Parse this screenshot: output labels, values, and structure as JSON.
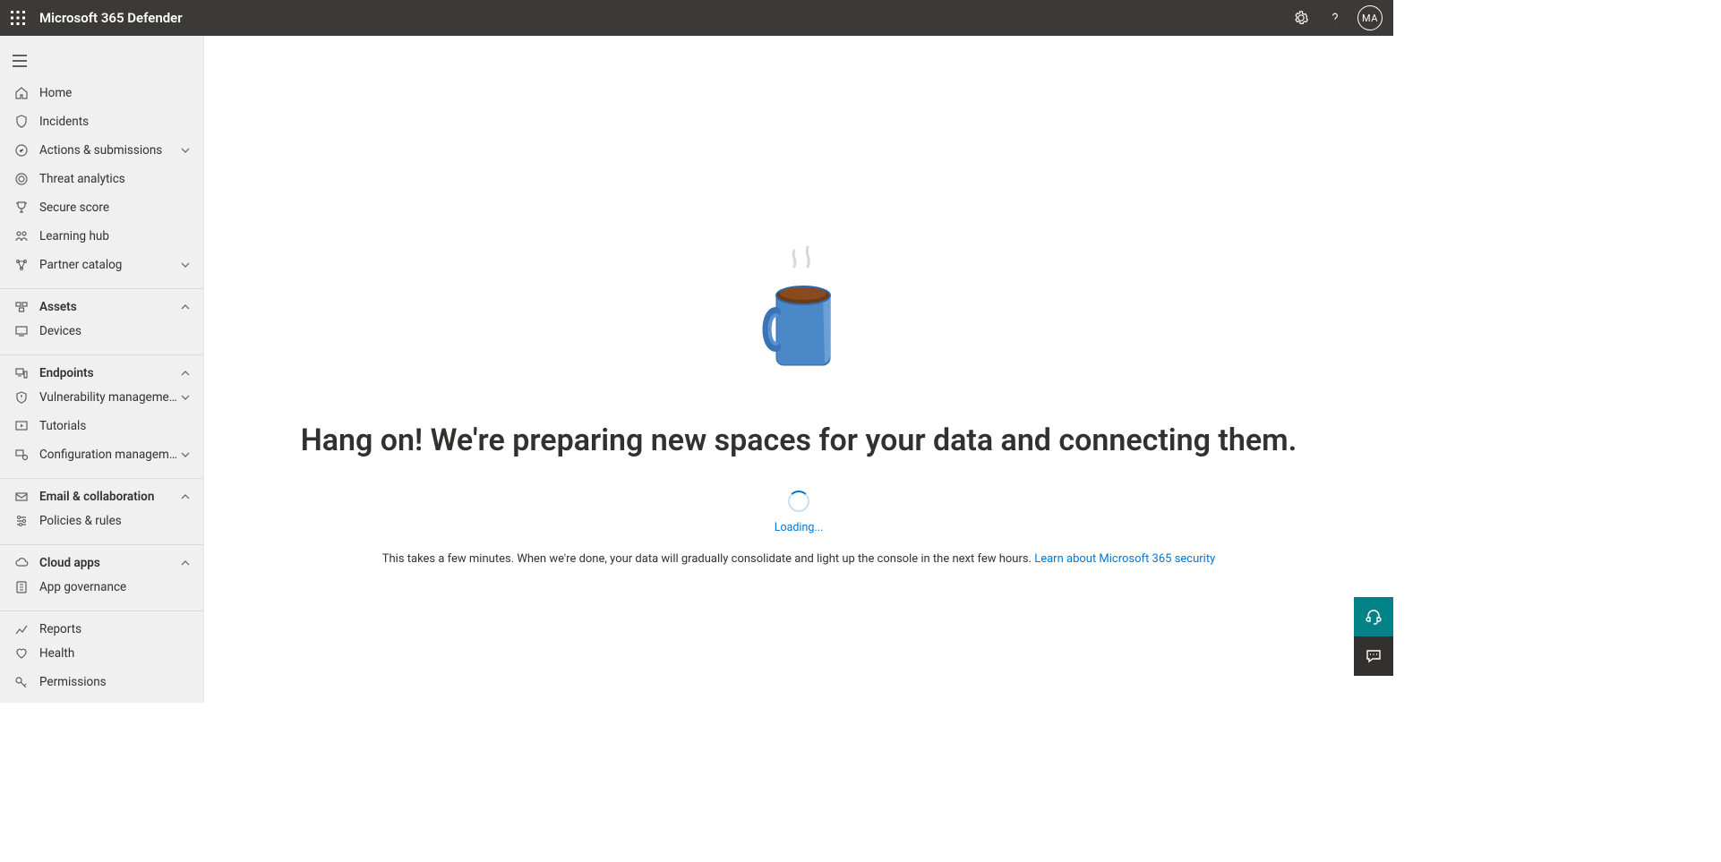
{
  "header": {
    "app_title": "Microsoft 365 Defender",
    "avatar_initials": "MA"
  },
  "sidebar": {
    "items": [
      {
        "label": "Home"
      },
      {
        "label": "Incidents"
      },
      {
        "label": "Actions & submissions"
      },
      {
        "label": "Threat analytics"
      },
      {
        "label": "Secure score"
      },
      {
        "label": "Learning hub"
      },
      {
        "label": "Partner catalog"
      }
    ],
    "assets_header": "Assets",
    "assets_items": [
      {
        "label": "Devices"
      }
    ],
    "endpoints_header": "Endpoints",
    "endpoints_items": [
      {
        "label": "Vulnerability management"
      },
      {
        "label": "Tutorials"
      },
      {
        "label": "Configuration management"
      }
    ],
    "email_header": "Email & collaboration",
    "email_items": [
      {
        "label": "Policies & rules"
      }
    ],
    "cloud_header": "Cloud apps",
    "cloud_items": [
      {
        "label": "App governance"
      }
    ],
    "bottom_items": [
      {
        "label": "Reports"
      },
      {
        "label": "Health"
      },
      {
        "label": "Permissions"
      }
    ]
  },
  "main": {
    "heading": "Hang on! We're preparing new spaces for your data and connecting them.",
    "loading_label": "Loading...",
    "description": "This takes a few minutes. When we're done, your data will gradually consolidate and light up the console in the next few hours. ",
    "learn_link": "Learn about Microsoft 365 security"
  }
}
